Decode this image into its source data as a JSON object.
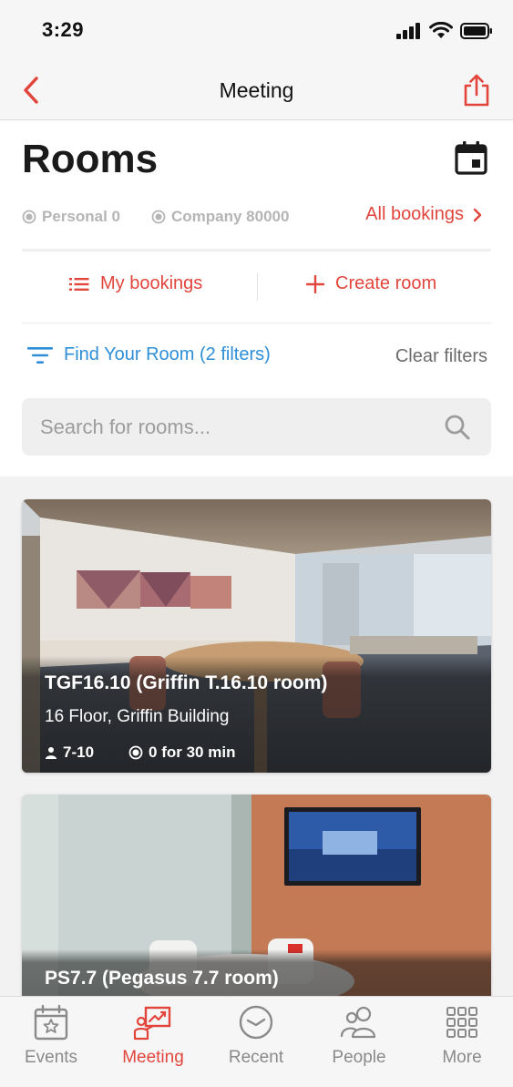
{
  "status_bar": {
    "time": "3:29"
  },
  "nav": {
    "title": "Meeting"
  },
  "header": {
    "title": "Rooms"
  },
  "stats": {
    "personal": "Personal 0",
    "company": "Company 80000",
    "all_bookings": "All bookings"
  },
  "actions": {
    "my_bookings": "My bookings",
    "create_room": "Create room"
  },
  "filters": {
    "find_label": "Find Your Room (2 filters)",
    "clear_label": "Clear filters"
  },
  "search": {
    "placeholder": "Search for rooms..."
  },
  "rooms": [
    {
      "name": "TGF16.10 (Griffin T.16.10 room)",
      "location": "16 Floor, Griffin Building",
      "capacity": "7-10",
      "availability": "0 for 30 min"
    },
    {
      "name": "PS7.7 (Pegasus 7.7 room)"
    }
  ],
  "tabs": [
    {
      "label": "Events",
      "icon": "calendar-star-icon",
      "active": false
    },
    {
      "label": "Meeting",
      "icon": "presentation-icon",
      "active": true
    },
    {
      "label": "Recent",
      "icon": "clock-icon",
      "active": false
    },
    {
      "label": "People",
      "icon": "people-icon",
      "active": false
    },
    {
      "label": "More",
      "icon": "grid-icon",
      "active": false
    }
  ],
  "colors": {
    "accent": "#e2453c",
    "link_blue": "#2e8fd8",
    "muted": "#b5b5b5"
  }
}
